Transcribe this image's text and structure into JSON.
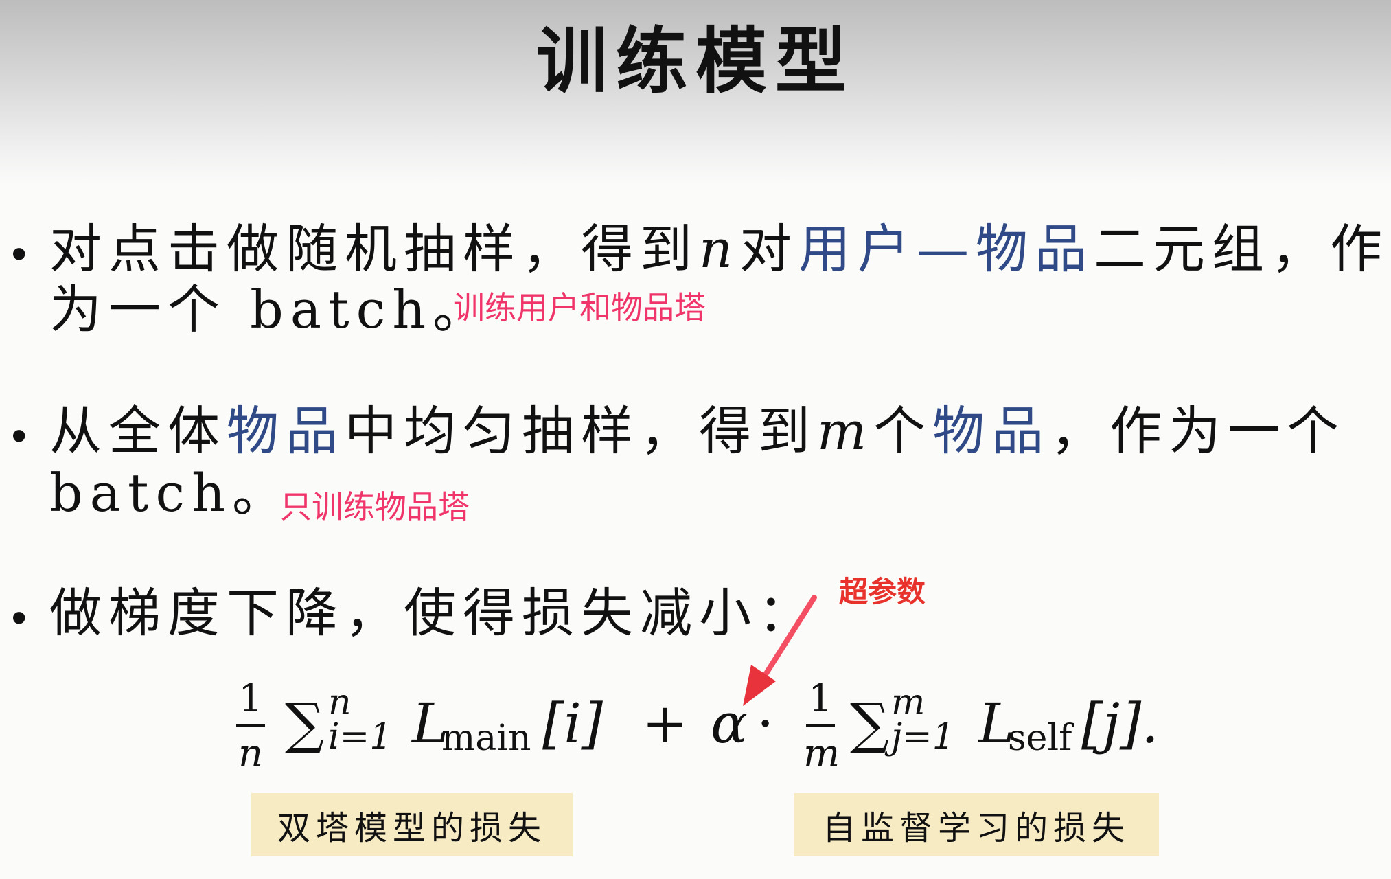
{
  "title": "训练模型",
  "bullets": [
    {
      "line1_a": "对点击做随机抽样，得到",
      "line1_var": "n",
      "line1_b": "对",
      "line1_hl": "用户—物品",
      "line1_c": "二元组，作",
      "line2": "为一个 batch。",
      "note": "训练用户和物品塔"
    },
    {
      "line1_a": "从全体",
      "line1_hl1": "物品",
      "line1_b": "中均匀抽样，得到",
      "line1_var": "m",
      "line1_c": "个",
      "line1_hl2": "物品",
      "line1_d": "，作为一个",
      "line2": "batch。",
      "note": "只训练物品塔"
    },
    {
      "line1": "做梯度下降，使得损失减小："
    }
  ],
  "formula": {
    "frac1_num": "1",
    "frac1_den": "n",
    "sigma": "∑",
    "sum1_upper": "n",
    "sum1_lower": "i=1",
    "loss_main": "L",
    "loss_main_sub": "main",
    "index_main": "[i]",
    "plus": "+",
    "alpha": "α",
    "dot": "·",
    "frac2_num": "1",
    "frac2_den": "m",
    "sum2_upper": "m",
    "sum2_lower": "j=1",
    "loss_self": "L",
    "loss_self_sub": "self",
    "index_self": "[j].",
    "hyperparam_note": "超参数"
  },
  "labels": {
    "two_tower_loss": "双塔模型的损失",
    "self_supervised_loss": "自监督学习的损失"
  },
  "colors": {
    "highlight": "#2f4a86",
    "note_pink": "#f0356a",
    "note_red": "#e8322c",
    "label_bg": "#f7ebc4"
  }
}
